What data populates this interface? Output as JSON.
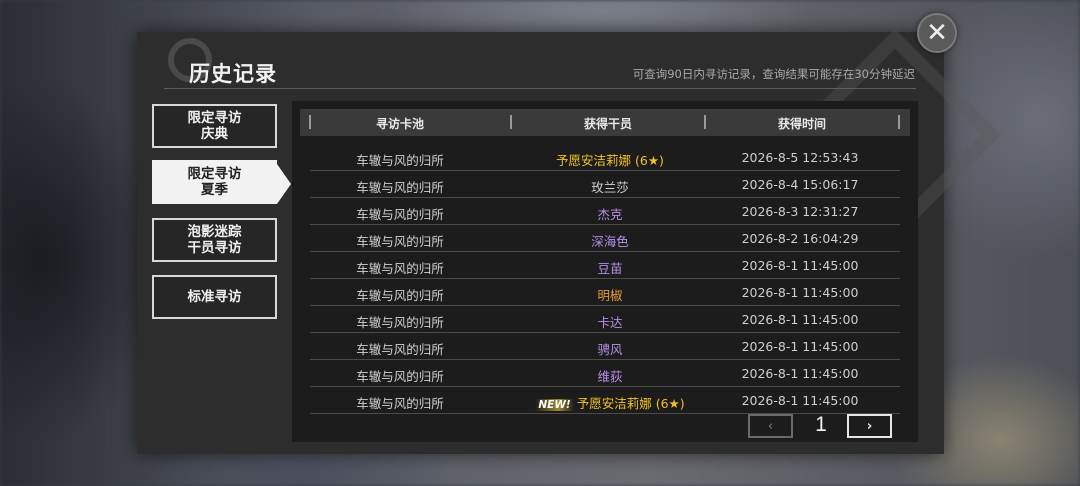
{
  "header": {
    "title": "历史记录",
    "subtitle": "可查询90日内寻访记录，查询结果可能存在30分钟延迟",
    "close_icon": "✕"
  },
  "sidebar": {
    "tabs": [
      {
        "line1": "限定寻访",
        "line2": "庆典",
        "active": false
      },
      {
        "line1": "限定寻访",
        "line2": "夏季",
        "active": true
      },
      {
        "line1": "泡影迷踪",
        "line2": "干员寻访",
        "active": false
      },
      {
        "line1": "标准寻访",
        "line2": "",
        "active": false
      }
    ]
  },
  "table": {
    "columns": [
      "寻访卡池",
      "获得干员",
      "获得时间"
    ],
    "rows": [
      {
        "pool": "车辙与风的归所",
        "operator": "予愿安洁莉娜 (6★)",
        "rarity_color": "#f0c02a",
        "time": "2026-8-5 12:53:43",
        "new": ""
      },
      {
        "pool": "车辙与风的归所",
        "operator": "玫兰莎",
        "rarity_color": "#cfcfcf",
        "time": "2026-8-4 15:06:17",
        "new": ""
      },
      {
        "pool": "车辙与风的归所",
        "operator": "杰克",
        "rarity_color": "#b690e8",
        "time": "2026-8-3 12:31:27",
        "new": ""
      },
      {
        "pool": "车辙与风的归所",
        "operator": "深海色",
        "rarity_color": "#b690e8",
        "time": "2026-8-2 16:04:29",
        "new": ""
      },
      {
        "pool": "车辙与风的归所",
        "operator": "豆苗",
        "rarity_color": "#b690e8",
        "time": "2026-8-1 11:45:00",
        "new": ""
      },
      {
        "pool": "车辙与风的归所",
        "operator": "明椒",
        "rarity_color": "#e69a3a",
        "time": "2026-8-1 11:45:00",
        "new": ""
      },
      {
        "pool": "车辙与风的归所",
        "operator": "卡达",
        "rarity_color": "#b690e8",
        "time": "2026-8-1 11:45:00",
        "new": ""
      },
      {
        "pool": "车辙与风的归所",
        "operator": "骋风",
        "rarity_color": "#b690e8",
        "time": "2026-8-1 11:45:00",
        "new": ""
      },
      {
        "pool": "车辙与风的归所",
        "operator": "维荻",
        "rarity_color": "#b690e8",
        "time": "2026-8-1 11:45:00",
        "new": ""
      },
      {
        "pool": "车辙与风的归所",
        "operator": "予愿安洁莉娜 (6★)",
        "rarity_color": "#f0c02a",
        "time": "2026-8-1 11:45:00",
        "new": "NEW!"
      }
    ]
  },
  "pager": {
    "page": "1",
    "prev_icon": "‹",
    "next_icon": "›"
  }
}
